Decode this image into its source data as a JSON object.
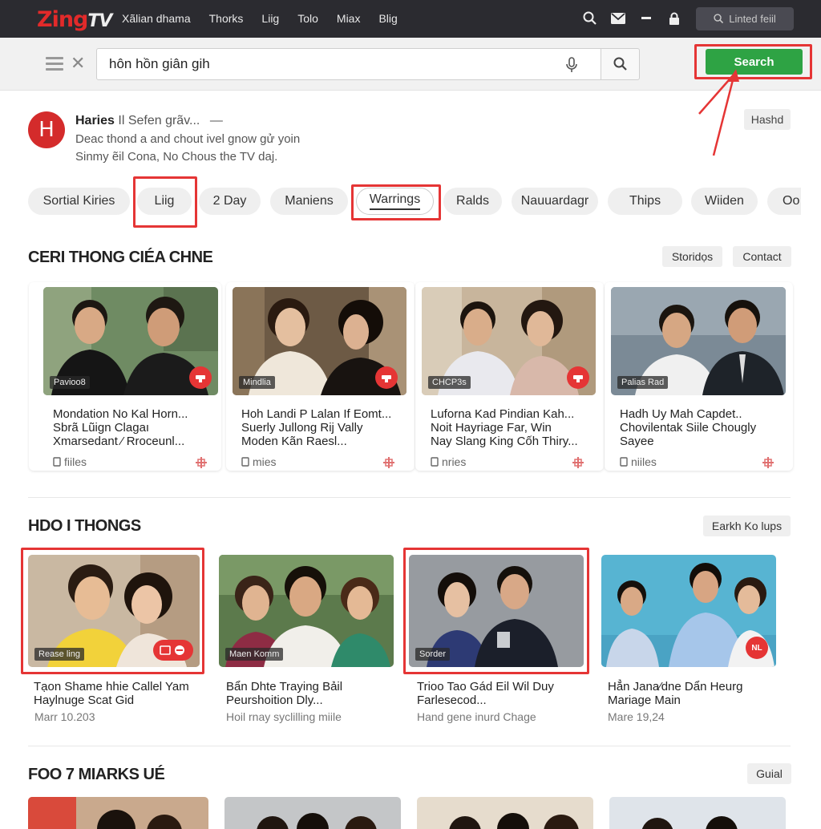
{
  "brand": {
    "logo_z": "Zing",
    "logo_tv": "TV"
  },
  "nav": {
    "links": [
      "Xãlian dhama",
      "Thorks",
      "Liig",
      "Tolo",
      "Miax",
      "Blig"
    ],
    "login_label": "Linted feiil"
  },
  "search": {
    "query": "hôn hồn giân gih",
    "button_label": "Search"
  },
  "channel": {
    "avatar_letter": "H",
    "name": "Haries",
    "subtitle": "Il Sefen grãv...",
    "dash": "—",
    "line1": "Deac thond a and chout ivel gnow gử yoin",
    "line2": "Sinmy ẽil Cona, No Chous the TV daj.",
    "action_label": "Hashd"
  },
  "chips": [
    "Sortial Kiries",
    "Liig",
    "2 Day",
    "Maniens",
    "Warrings",
    "Ralds",
    "Nauuardagr",
    "Thips",
    "Wiiden",
    "Oo"
  ],
  "section1": {
    "title": "CERI THONG CIÉA CHNE",
    "btn_a": "Storidọs",
    "btn_b": "Contact",
    "cards": [
      {
        "tag": "Pavioo8",
        "l1": "Mondation No Kal Horn...",
        "l2": "Sbrã Lũign Clagaı",
        "l3": "Xmarsedant ⁄ Rroceunl...",
        "meta": "fiiles"
      },
      {
        "tag": "Mindlia",
        "l1": "Hoh Landi P Lalan If Eomt...",
        "l2": "Suerly Jullong Rij Vally",
        "l3": "Moden Kãn Raesl...",
        "meta": "mies"
      },
      {
        "tag": "CHCP3s",
        "l1": "Luforna Kad Pindian Kah...",
        "l2": "Noit Hayriage Far, Win",
        "l3": "Nay Slang King Cốh Thiry...",
        "meta": "nries"
      },
      {
        "tag": "Palias Rad",
        "l1": "Hadh Uy Mah Capdet..",
        "l2": "Chovilentak Siile Chougly",
        "l3": "Sayee",
        "meta": "niiles"
      }
    ]
  },
  "section2": {
    "title": "HDO I THONGS",
    "btn": "Earkh Ko lups",
    "cards": [
      {
        "tag": "Rease ling",
        "l1": "Tạon Shame hhie Callel Yam",
        "l2": "Haylnuge Scat Gid",
        "meta": "Marr 10.203"
      },
      {
        "tag": "Maen Komm",
        "l1": "Bẩn Dhte Traying Bảil",
        "l2": "Peurshoition Dly...",
        "meta": "Hoil rnay syclilling miile"
      },
      {
        "tag": "Sorder",
        "l1": "Trioo Tao Gád Eil Wil Duy",
        "l2": "Farlesecod...",
        "meta": "Hand gene inurd Chage"
      },
      {
        "tag": "NL",
        "l1": "Hẳn Jana⁄dne Dẩn Heurg",
        "l2": "Mariage Main",
        "meta": "Mare 19,24"
      }
    ]
  },
  "section3": {
    "title": "FOO 7 MIARKS UÉ",
    "btn": "Guial"
  },
  "colors": {
    "accent_red": "#e53535",
    "search_green": "#2ea344",
    "nav_bg": "#2b2b30"
  }
}
